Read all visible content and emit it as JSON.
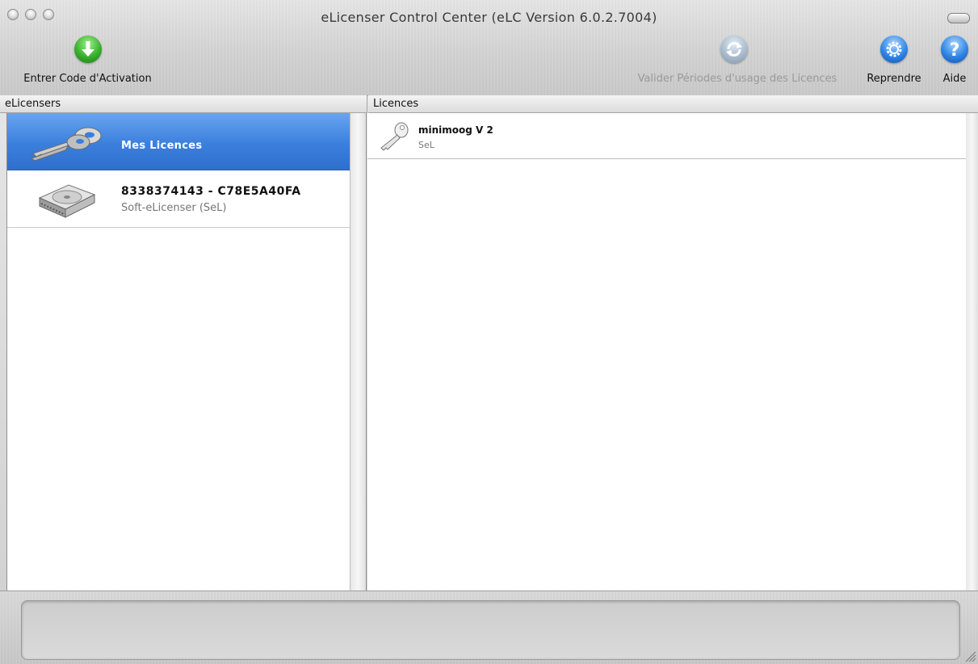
{
  "window": {
    "title": "eLicenser Control Center (eLC Version 6.0.2.7004)"
  },
  "toolbar": {
    "enter_code": "Entrer Code d'Activation",
    "validate_periods": "Valider Périodes d'usage des Licences",
    "reprendre": "Reprendre",
    "aide": "Aide"
  },
  "headers": {
    "elicensers": "eLicensers",
    "licences": "Licences"
  },
  "elicensers": [
    {
      "title": "Mes Licences",
      "subtitle": "",
      "icon": "keys-icon",
      "selected": true
    },
    {
      "title": "8338374143 - C78E5A40FA",
      "subtitle": "Soft-eLicenser (SeL)",
      "icon": "hard-drive-icon",
      "selected": false
    }
  ],
  "licences": [
    {
      "name": "minimoog V 2",
      "sub": "SeL",
      "icon": "key-icon"
    }
  ],
  "colors": {
    "selection": "#3b7fdd",
    "green_button": "#37b12c",
    "blue_button": "#2f86e6"
  }
}
